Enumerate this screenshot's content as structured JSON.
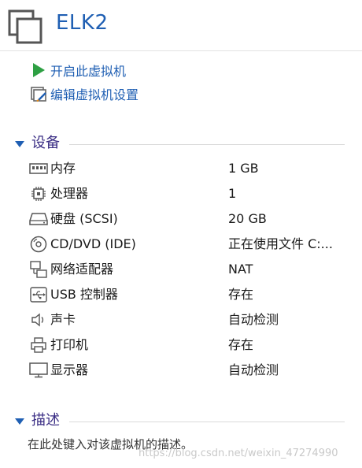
{
  "vm": {
    "name": "ELK2"
  },
  "actions": [
    {
      "label": "开启此虚拟机",
      "icon": "play-icon"
    },
    {
      "label": "编辑虚拟机设置",
      "icon": "edit-settings-icon"
    }
  ],
  "devices_section": {
    "title": "设备",
    "items": [
      {
        "name": "内存",
        "value": "1 GB",
        "icon": "memory-icon"
      },
      {
        "name": "处理器",
        "value": "1",
        "icon": "processor-icon"
      },
      {
        "name": "硬盘 (SCSI)",
        "value": "20 GB",
        "icon": "hard-disk-icon"
      },
      {
        "name": "CD/DVD (IDE)",
        "value": "正在使用文件 C:...",
        "icon": "cd-dvd-icon"
      },
      {
        "name": "网络适配器",
        "value": "NAT",
        "icon": "network-adapter-icon"
      },
      {
        "name": "USB 控制器",
        "value": "存在",
        "icon": "usb-icon"
      },
      {
        "name": "声卡",
        "value": "自动检测",
        "icon": "speaker-icon"
      },
      {
        "name": "打印机",
        "value": "存在",
        "icon": "printer-icon"
      },
      {
        "name": "显示器",
        "value": "自动检测",
        "icon": "monitor-icon"
      }
    ]
  },
  "description_section": {
    "title": "描述",
    "placeholder": "在此处键入对该虚拟机的描述。"
  },
  "watermark": "https://blog.csdn.net/weixin_47274990",
  "colors": {
    "accent": "#1f5fb3",
    "section_title": "#3a2d84",
    "play_green": "#2ea043"
  }
}
